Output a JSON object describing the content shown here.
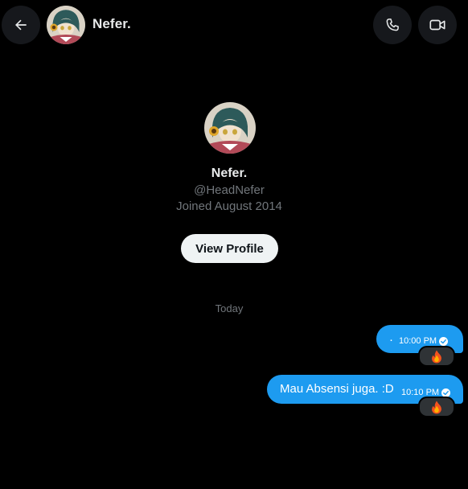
{
  "header": {
    "name": "Nefer."
  },
  "profile": {
    "name": "Nefer.",
    "handle": "@HeadNefer",
    "joined": "Joined August 2014",
    "view_profile_label": "View Profile"
  },
  "conversation": {
    "day_label": "Today",
    "messages": [
      {
        "text": "·",
        "time": "10:00 PM",
        "reaction": "fire-emoji"
      },
      {
        "text": "Mau Absensi juga. :D",
        "time": "10:10 PM",
        "reaction": "fire-emoji"
      }
    ]
  },
  "colors": {
    "accent": "#1d9bf0",
    "background": "#000000",
    "muted_text": "#71767b",
    "primary_text": "#e7e9ea"
  },
  "icons": [
    "arrow-left-icon",
    "phone-icon",
    "video-camera-icon",
    "checkmark-circle-icon",
    "fire-emoji-icon"
  ]
}
